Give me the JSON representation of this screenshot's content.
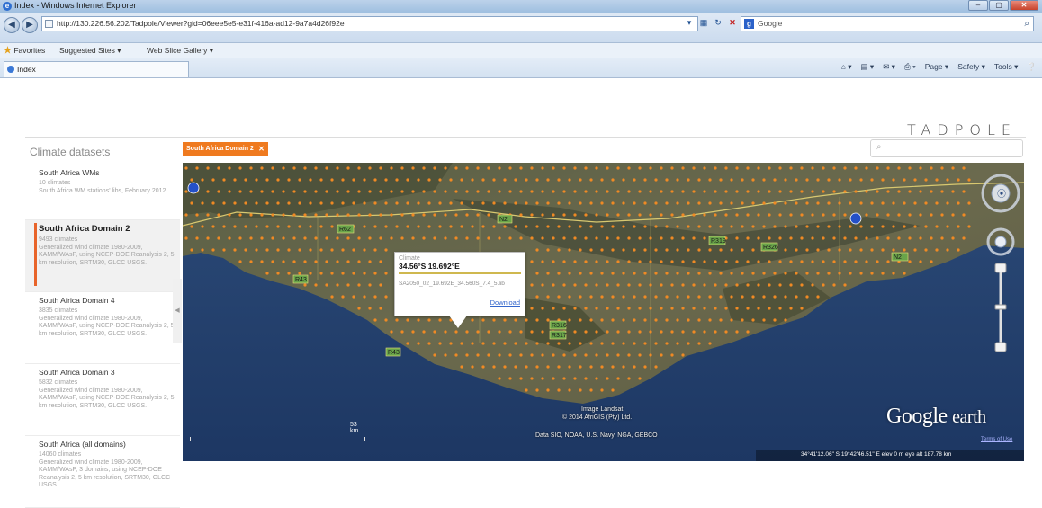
{
  "browser": {
    "window_title": "Index - Windows Internet Explorer",
    "url": "http://130.226.56.202/Tadpole/Viewer?gid=06eee5e5-e31f-416a-ad12-9a7a4d26f92e",
    "search_engine": "Google",
    "favorites_label": "Favorites",
    "suggested_sites": "Suggested Sites ▾",
    "web_slice": "Web Slice Gallery ▾",
    "tab_title": "Index",
    "commands": [
      "Page ▾",
      "Safety ▾",
      "Tools ▾"
    ]
  },
  "app": {
    "brand": "TADPOLE",
    "sidebar_title": "Climate datasets",
    "datasets": [
      {
        "name": "South Africa WMs",
        "count": "10 climates",
        "desc": "South Africa WM stations' libs, February 2012",
        "active": false
      },
      {
        "name": "South Africa Domain 2",
        "count": "9493 climates",
        "desc": "Generalized wind climate 1980-2009, KAMM/WAsP, using NCEP-DOE Reanalysis 2, 5 km resolution, SRTM30, GLCC USGS.",
        "active": true
      },
      {
        "name": "South Africa Domain 4",
        "count": "3835 climates",
        "desc": "Generalized wind climate 1980-2009, KAMM/WAsP, using NCEP-DOE Reanalysis 2, 5 km resolution, SRTM30, GLCC USGS.",
        "active": false
      },
      {
        "name": "South Africa Domain 3",
        "count": "5832 climates",
        "desc": "Generalized wind climate 1980-2009, KAMM/WAsP, using NCEP-DOE Reanalysis 2, 5 km resolution, SRTM30, GLCC USGS.",
        "active": false
      },
      {
        "name": "South Africa (all domains)",
        "count": "14060 climates",
        "desc": "Generalized wind climate 1980-2009, KAMM/WAsP, 3 domains, using NCEP-DOE Reanalysis 2, 5 km resolution, SRTM30, GLCC USGS.",
        "active": false
      }
    ],
    "selected_chip": "South Africa Domain 2",
    "search_placeholder": ""
  },
  "map": {
    "popup": {
      "label": "Climate",
      "coord": "34.56°S 19.692°E",
      "code": "SA2050_02_19.692E_34.560S_7.4_5.lib",
      "download": "Download"
    },
    "road_labels": [
      "R62",
      "N2",
      "R43",
      "N2",
      "R316",
      "R317",
      "R319",
      "R326",
      "R43",
      "N2"
    ],
    "attribution_1": "Image Landsat",
    "attribution_2": "© 2014 AfriGIS (Pty) Ltd.",
    "attribution_3": "Data SIO, NOAA, U.S. Navy, NGA, GEBCO",
    "scale": "53 km",
    "logo_main": "Google",
    "logo_sub": "earth",
    "terms": "Terms of Use",
    "status": "34°41'12.06\" S  19°42'46.51\" E  elev   0 m    eye alt 187.78 km"
  }
}
